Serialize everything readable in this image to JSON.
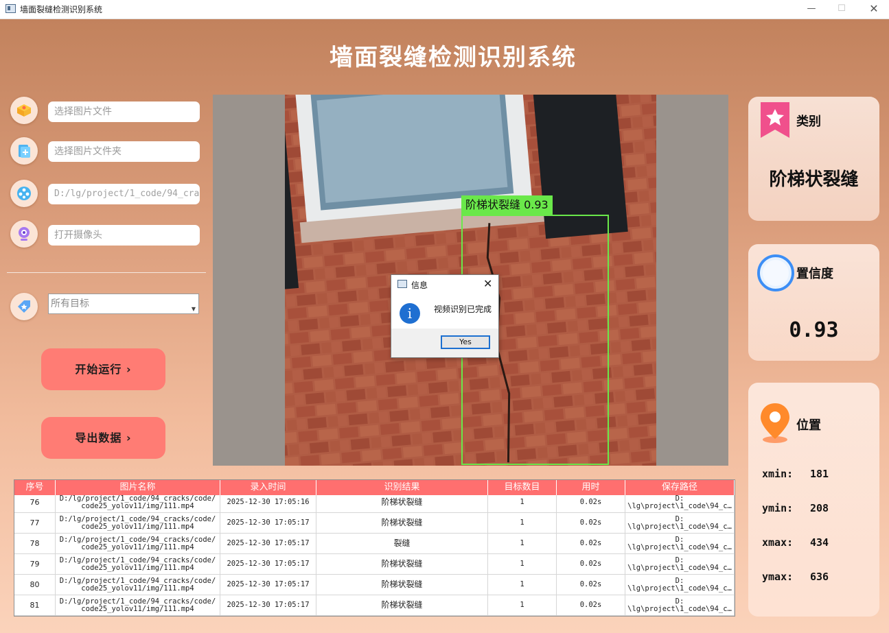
{
  "window": {
    "title": "墙面裂缝检测识别系统"
  },
  "app_title": "墙面裂缝检测识别系统",
  "inputs": {
    "image_file_placeholder": "选择图片文件",
    "image_folder_placeholder": "选择图片文件夹",
    "video_path": "D:/lg/project/1_code/94_cra",
    "camera_placeholder": "打开摄像头",
    "target_select": "所有目标"
  },
  "buttons": {
    "start": "开始运行 ›",
    "export": "导出数据 ›"
  },
  "detection": {
    "label": "阶梯状裂缝 0.93"
  },
  "dialog": {
    "title": "信息",
    "message": "视频识别已完成",
    "yes": "Yes"
  },
  "result": {
    "category_title": "类别",
    "category_value": "阶梯状裂缝",
    "confidence_title": "置信度",
    "confidence_value": "0.93",
    "position_title": "位置",
    "xmin_label": "xmin:",
    "xmin": "181",
    "ymin_label": "ymin:",
    "ymin": "208",
    "xmax_label": "xmax:",
    "xmax": "434",
    "ymax_label": "ymax:",
    "ymax": "636"
  },
  "table": {
    "columns": [
      "序号",
      "图片名称",
      "录入时间",
      "识别结果",
      "目标数目",
      "用时",
      "保存路径"
    ],
    "rows": [
      [
        "76",
        "D:/lg/project/1_code/94_cracks/code/\ncode25_yolov11/img/111.mp4",
        "2025-12-30 17:05:16",
        "阶梯状裂缝",
        "1",
        "0.02s",
        "D:\n\\lg\\project\\1_code\\94_c…"
      ],
      [
        "77",
        "D:/lg/project/1_code/94_cracks/code/\ncode25_yolov11/img/111.mp4",
        "2025-12-30 17:05:17",
        "阶梯状裂缝",
        "1",
        "0.02s",
        "D:\n\\lg\\project\\1_code\\94_c…"
      ],
      [
        "78",
        "D:/lg/project/1_code/94_cracks/code/\ncode25_yolov11/img/111.mp4",
        "2025-12-30 17:05:17",
        "裂缝",
        "1",
        "0.02s",
        "D:\n\\lg\\project\\1_code\\94_c…"
      ],
      [
        "79",
        "D:/lg/project/1_code/94_cracks/code/\ncode25_yolov11/img/111.mp4",
        "2025-12-30 17:05:17",
        "阶梯状裂缝",
        "1",
        "0.02s",
        "D:\n\\lg\\project\\1_code\\94_c…"
      ],
      [
        "80",
        "D:/lg/project/1_code/94_cracks/code/\ncode25_yolov11/img/111.mp4",
        "2025-12-30 17:05:17",
        "阶梯状裂缝",
        "1",
        "0.02s",
        "D:\n\\lg\\project\\1_code\\94_c…"
      ],
      [
        "81",
        "D:/lg/project/1_code/94_cracks/code/\ncode25_yolov11/img/111.mp4",
        "2025-12-30 17:05:17",
        "阶梯状裂缝",
        "1",
        "0.02s",
        "D:\n\\lg\\project\\1_code\\94_c…"
      ]
    ]
  },
  "colors": {
    "accent": "#ff7c74",
    "table_header": "#ff6f6f",
    "detection": "#6ae84a"
  }
}
